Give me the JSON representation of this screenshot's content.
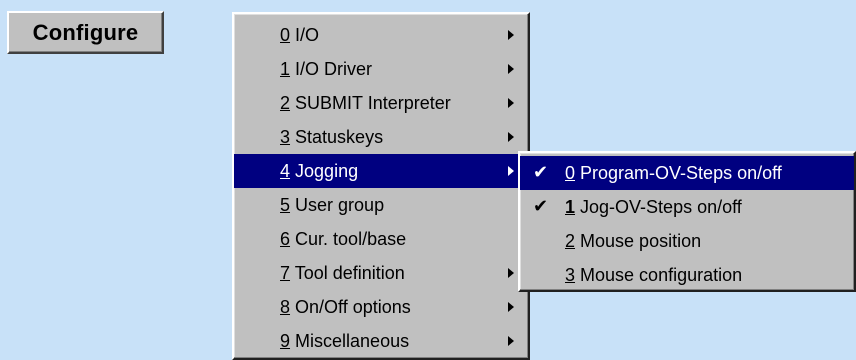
{
  "menubar": {
    "configure_label": "Configure"
  },
  "main_menu": {
    "items": [
      {
        "key": "0",
        "text": "I/O",
        "has_submenu": true
      },
      {
        "key": "1",
        "text": "I/O Driver",
        "has_submenu": true
      },
      {
        "key": "2",
        "text": "SUBMIT Interpreter",
        "has_submenu": true
      },
      {
        "key": "3",
        "text": "Statuskeys",
        "has_submenu": true
      },
      {
        "key": "4",
        "text": "Jogging",
        "has_submenu": true,
        "selected": true
      },
      {
        "key": "5",
        "text": "User group",
        "has_submenu": false
      },
      {
        "key": "6",
        "text": "Cur. tool/base",
        "has_submenu": false
      },
      {
        "key": "7",
        "text": "Tool definition",
        "has_submenu": true
      },
      {
        "key": "8",
        "text": "On/Off options",
        "has_submenu": true
      },
      {
        "key": "9",
        "text": "Miscellaneous",
        "has_submenu": true
      }
    ]
  },
  "jogging_submenu": {
    "items": [
      {
        "key": "0",
        "text": "Program-OV-Steps on/off",
        "checked": true,
        "selected": true
      },
      {
        "key": "1",
        "text": "Jog-OV-Steps on/off",
        "checked": true
      },
      {
        "key": "2",
        "text": "Mouse position",
        "checked": false
      },
      {
        "key": "3",
        "text": "Mouse configuration",
        "checked": false
      }
    ],
    "check_glyph": "✔"
  },
  "colors": {
    "desktop": "#c8e1f8",
    "menu_face": "#c0c0c0",
    "highlight": "#000080"
  }
}
